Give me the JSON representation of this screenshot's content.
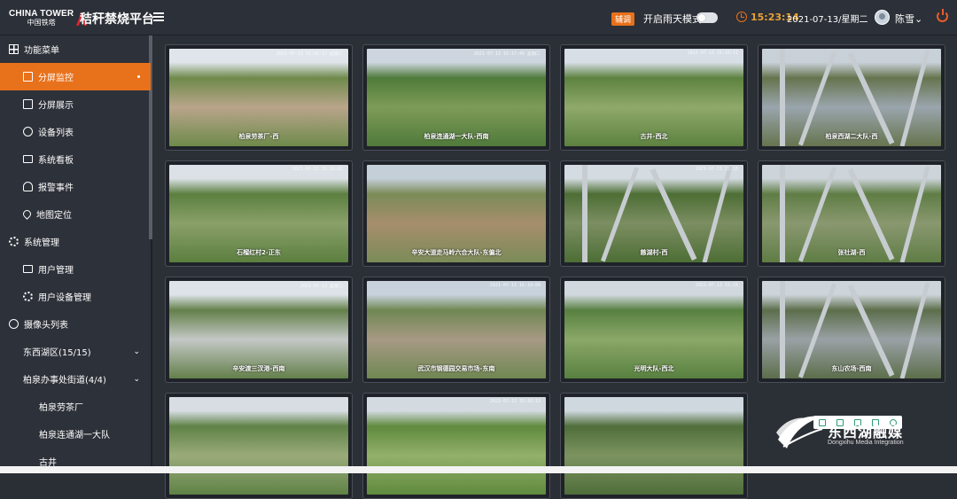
{
  "header": {
    "logo_en": "CHINA TOWER",
    "logo_cn": "中国铁塔",
    "app_title": "秸秆禁烧平台",
    "badge": "辅调",
    "rain_mode_label": "开启雨天模式",
    "rain_mode_on": false,
    "time": "15:23:14",
    "date": "2021-07-13/星期二",
    "user": "陈雪",
    "accent_color": "#e8711b"
  },
  "sidebar": {
    "items": [
      {
        "label": "功能菜单",
        "icon": "grid-icon",
        "level": 0
      },
      {
        "label": "分屏监控",
        "icon": "bars-icon",
        "level": 1,
        "active": true
      },
      {
        "label": "分屏展示",
        "icon": "bars-icon",
        "level": 1
      },
      {
        "label": "设备列表",
        "icon": "circle-icon",
        "level": 1
      },
      {
        "label": "系统看板",
        "icon": "screen-icon",
        "level": 1
      },
      {
        "label": "报警事件",
        "icon": "alarm-icon",
        "level": 1
      },
      {
        "label": "地图定位",
        "icon": "pin-icon",
        "level": 1
      },
      {
        "label": "系统管理",
        "icon": "gear-icon",
        "level": 0
      },
      {
        "label": "用户管理",
        "icon": "user-card-icon",
        "level": 1
      },
      {
        "label": "用户设备管理",
        "icon": "gear-icon",
        "level": 1
      },
      {
        "label": "摄像头列表",
        "icon": "search-icon",
        "level": 0
      },
      {
        "label": "东西湖区(15/15)",
        "level": 1,
        "expandable": true
      },
      {
        "label": "柏泉办事处街道(4/4)",
        "level": 2,
        "expandable": true
      },
      {
        "label": "柏泉劳茶厂",
        "level": 3
      },
      {
        "label": "柏泉连通湖一大队",
        "level": 3
      },
      {
        "label": "古井",
        "level": 3
      }
    ]
  },
  "cameras": [
    {
      "caption": "柏泉劳茶厂-西",
      "timestamp": "2021-07-13 15:16:17 星期二"
    },
    {
      "caption": "柏泉连通湖一大队-西南",
      "timestamp": "2021-07-13 15:17:45 星期二"
    },
    {
      "caption": "古井-西北",
      "timestamp": "2021-07-13 15:16:11"
    },
    {
      "caption": "柏泉西湖二大队-西",
      "timestamp": ""
    },
    {
      "caption": "石榴红村2-正东",
      "timestamp": "2021-07-13 15:16:01"
    },
    {
      "caption": "辛安大道走马岭六合大队-东偏北",
      "timestamp": ""
    },
    {
      "caption": "慈湖村-西",
      "timestamp": "2021-07-13 15:16"
    },
    {
      "caption": "张社湖-西",
      "timestamp": ""
    },
    {
      "caption": "辛安渡三汊港-西南",
      "timestamp": "2021-07-13 星期二"
    },
    {
      "caption": "武汉市钢德园交易市场-东南",
      "timestamp": "2021-07-13 16:19:09"
    },
    {
      "caption": "光明大队-西北",
      "timestamp": "2021-07-13 15:16"
    },
    {
      "caption": "东山农场-西南",
      "timestamp": ""
    },
    {
      "caption": "",
      "timestamp": ""
    },
    {
      "caption": "",
      "timestamp": "2021-07-13 15:16:13"
    },
    {
      "caption": "",
      "timestamp": ""
    }
  ],
  "watermark": {
    "cn": "东西湖融媒",
    "en": "Dongxihu Media Integration"
  }
}
